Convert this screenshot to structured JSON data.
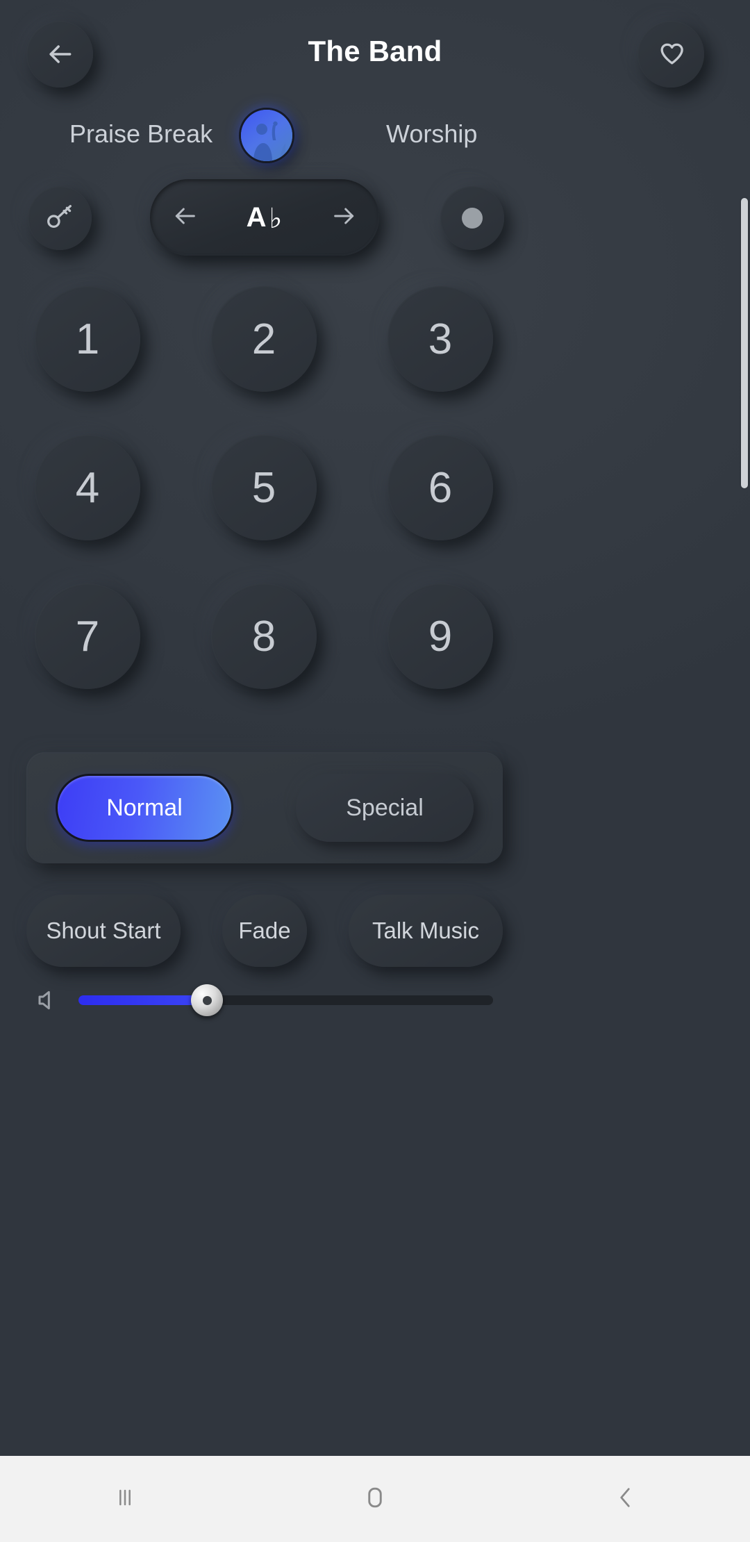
{
  "header": {
    "title": "The Band",
    "back_icon": "arrow-left-icon",
    "favorite_icon": "heart-icon"
  },
  "tabs": {
    "left_label": "Praise Break",
    "right_label": "Worship",
    "avatar_icon": "worshipper-avatar-icon"
  },
  "key_selector": {
    "key_icon": "key-icon",
    "prev_icon": "arrow-left-icon",
    "next_icon": "arrow-right-icon",
    "note": "A",
    "accidental": "♭",
    "record_icon": "record-dot-icon"
  },
  "numpad": {
    "keys": [
      "1",
      "2",
      "3",
      "4",
      "5",
      "6",
      "7",
      "8",
      "9"
    ]
  },
  "mode": {
    "normal_label": "Normal",
    "special_label": "Special",
    "selected": "Normal",
    "active_color": "#4a58f8"
  },
  "actions": {
    "items": [
      {
        "label": "Shout Start"
      },
      {
        "label": "Fade"
      },
      {
        "label": "Talk Music"
      }
    ]
  },
  "volume": {
    "icon": "speaker-icon",
    "level_percent": 31,
    "fill_color": "#3b44f5"
  },
  "navbar": {
    "recents_icon": "recents-icon",
    "home_icon": "home-icon",
    "back_icon": "back-chevron-icon"
  },
  "scrollbar": {
    "position": "right"
  },
  "theme": {
    "background": "#343a42",
    "surface": "#2f353c",
    "text_primary": "#ffffff",
    "text_secondary": "#ccd1d8",
    "accent": "#4a58f8"
  }
}
